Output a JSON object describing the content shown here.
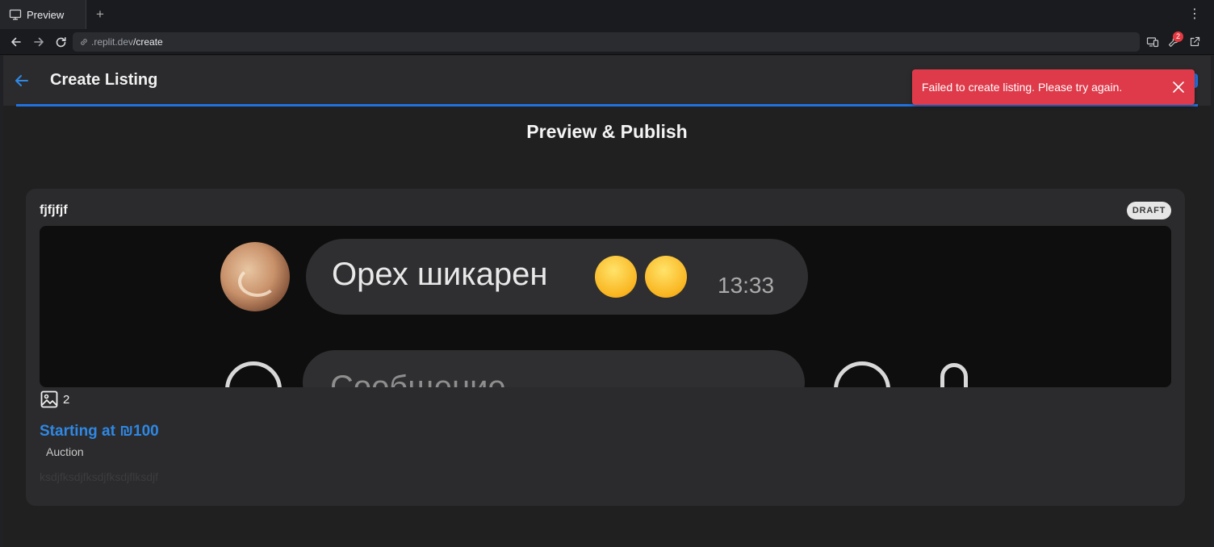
{
  "browser": {
    "tab_title": "Preview",
    "new_tab_symbol": "+",
    "menu_symbol": "⋮",
    "url_host": ".replit.dev",
    "url_path": "/create",
    "tools_badge_count": "2"
  },
  "header": {
    "title": "Create Listing"
  },
  "toast": {
    "message": "Failed to create listing. Please try again.",
    "color": "#de3a4a"
  },
  "page": {
    "title": "Preview & Publish"
  },
  "listing": {
    "title": "fjfjfjf",
    "status_badge": "DRAFT",
    "image_count": "2",
    "price": "Starting at ₪100",
    "type": "Auction",
    "description": "ksdjfksdjfksdjfksdjflksdjf",
    "preview_image": {
      "message_text": "Орех шикарен",
      "message_time": "13:33",
      "input_placeholder": "Сообщение"
    }
  },
  "colors": {
    "accent": "#2172e0",
    "price": "#2f88e4",
    "background": "#202020",
    "surface": "#2b2b2d"
  }
}
